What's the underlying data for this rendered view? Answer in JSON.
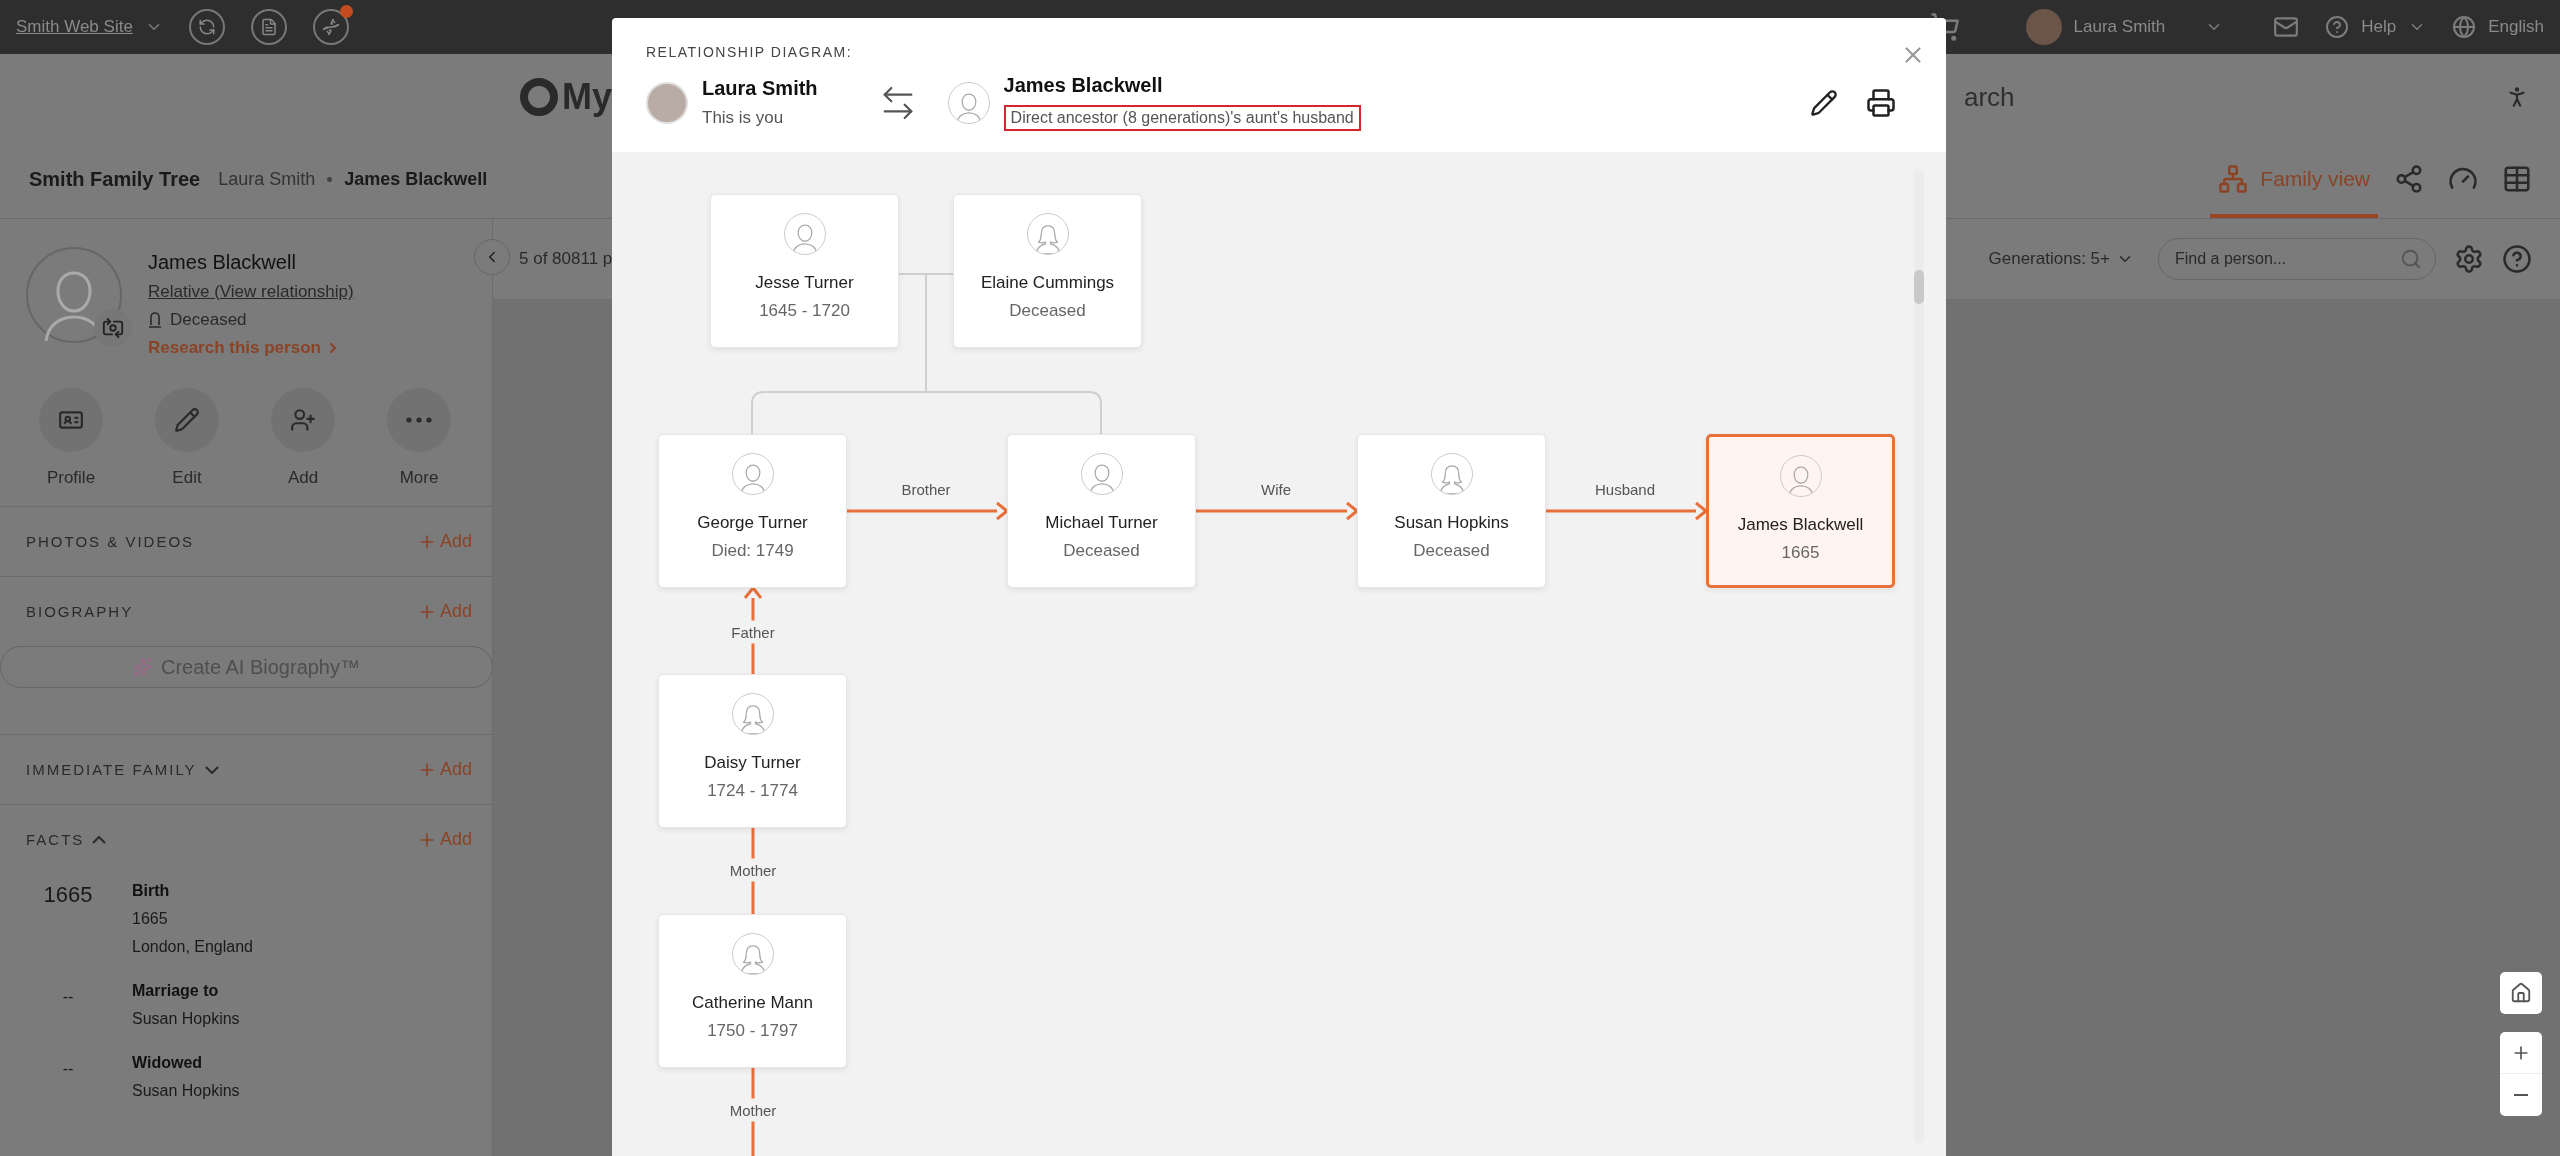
{
  "top_bar": {
    "site": "Smith Web Site",
    "user": "Laura Smith",
    "help": "Help",
    "language": "English"
  },
  "header": {
    "logo": "My",
    "search": {
      "placeholder": "arch"
    }
  },
  "breadcrumb": {
    "tree": "Smith Family Tree",
    "items": [
      "Laura Smith",
      "James Blackwell"
    ]
  },
  "view_tabs": [
    {
      "kind": "family",
      "label": "Family view",
      "selected": true
    },
    {
      "kind": "pedigree",
      "selected": false
    },
    {
      "kind": "fan",
      "selected": false
    },
    {
      "kind": "list",
      "selected": false
    }
  ],
  "toolbar": {
    "counter": "5 of 80811 p",
    "generations_label": "Generations:",
    "generations_value": "5+",
    "search": {
      "placeholder": "Find a person..."
    }
  },
  "profile": {
    "name": "James Blackwell",
    "relation": "Relative (View relationship)",
    "status": "Deceased",
    "research": "Research this person"
  },
  "actions": [
    {
      "kind": "profile",
      "label": "Profile"
    },
    {
      "kind": "edit",
      "label": "Edit"
    },
    {
      "kind": "add",
      "label": "Add"
    },
    {
      "kind": "more",
      "label": "More"
    }
  ],
  "media_section": {
    "title": "PHOTOS & VIDEOS",
    "add": "Add"
  },
  "biography_section": {
    "title": "BIOGRAPHY",
    "add": "Add",
    "ai_button": "Create AI Biography™"
  },
  "family_section": {
    "title": "IMMEDIATE FAMILY",
    "add": "Add",
    "expanded": false
  },
  "facts_section": {
    "title": "FACTS",
    "add": "Add",
    "expanded": true
  },
  "facts": [
    {
      "year": "1665",
      "title": "Birth",
      "lines": [
        "1665",
        "London, England"
      ]
    },
    {
      "year": "--",
      "title": "Marriage to",
      "lines": [
        "Susan Hopkins"
      ]
    },
    {
      "year": "--",
      "title": "Widowed",
      "lines": [
        "Susan Hopkins"
      ]
    }
  ],
  "dialog": {
    "title": "RELATIONSHIP DIAGRAM:",
    "from": {
      "name": "Laura Smith",
      "note": "This is you"
    },
    "to": {
      "name": "James Blackwell",
      "relation": "Direct ancestor (8 generations)'s aunt's husband"
    }
  },
  "diagram": {
    "nodes": [
      {
        "name": "Jesse Turner",
        "dates": "1645 - 1720",
        "kind": "male",
        "selected": false
      },
      {
        "name": "Elaine Cummings",
        "dates": "Deceased",
        "kind": "female",
        "selected": false
      },
      {
        "name": "George Turner",
        "dates": "Died: 1749",
        "kind": "male",
        "selected": false
      },
      {
        "name": "Michael Turner",
        "dates": "Deceased",
        "kind": "male",
        "selected": false
      },
      {
        "name": "Susan Hopkins",
        "dates": "Deceased",
        "kind": "female",
        "selected": false
      },
      {
        "name": "James Blackwell",
        "dates": "1665",
        "kind": "male",
        "selected": true
      },
      {
        "name": "Daisy Turner",
        "dates": "1724 - 1774",
        "kind": "female",
        "selected": false
      },
      {
        "name": "Catherine Mann",
        "dates": "1750 - 1797",
        "kind": "female",
        "selected": false
      }
    ],
    "links": [
      {
        "label": "Brother"
      },
      {
        "label": "Wife"
      },
      {
        "label": "Husband"
      },
      {
        "label": "Father"
      },
      {
        "label": "Mother"
      },
      {
        "label": "Mother"
      }
    ]
  }
}
